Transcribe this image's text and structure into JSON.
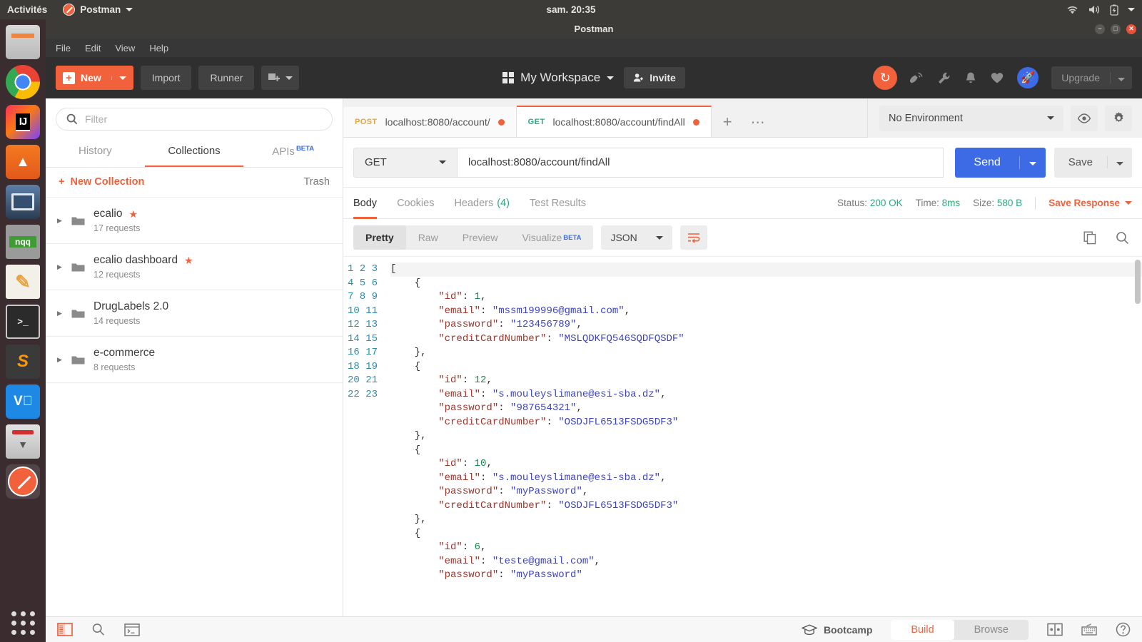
{
  "system": {
    "activities": "Activités",
    "app_menu": "Postman",
    "clock": "sam. 20:35",
    "tray_icons": [
      "wifi-icon",
      "volume-icon",
      "battery-icon",
      "chevron-down-icon"
    ]
  },
  "dock": {
    "items": [
      {
        "name": "files",
        "label": "Files",
        "running": true
      },
      {
        "name": "google-chrome",
        "label": "Google Chrome",
        "running": true
      },
      {
        "name": "intellij-idea",
        "label": "IJ",
        "running": true
      },
      {
        "name": "jetbrains-toolbox",
        "label": "Toolbox",
        "running": false
      },
      {
        "name": "virtualbox",
        "label": "VirtualBox",
        "running": false
      },
      {
        "name": "notepadqq",
        "label": "nqq",
        "running": false
      },
      {
        "name": "text-editor",
        "label": "Notes",
        "running": false
      },
      {
        "name": "terminal",
        "label": "Terminal",
        "running": true
      },
      {
        "name": "sublime-text",
        "label": "Sublime",
        "running": false
      },
      {
        "name": "vnc-viewer",
        "label": "VNC",
        "running": false
      },
      {
        "name": "scanner",
        "label": "Scanner",
        "running": false
      },
      {
        "name": "postman",
        "label": "Postman",
        "running": true
      }
    ],
    "show_apps": "Show Applications"
  },
  "window": {
    "title": "Postman",
    "minimize": "–",
    "maximize": "□",
    "close": "✕"
  },
  "menubar": {
    "items": [
      "File",
      "Edit",
      "View",
      "Help"
    ]
  },
  "header": {
    "new_label": "New",
    "import_label": "Import",
    "runner_label": "Runner",
    "workspace_label": "My Workspace",
    "invite_label": "Invite",
    "upgrade_label": "Upgrade",
    "icons": [
      "sync-icon",
      "satellite-icon",
      "wrench-icon",
      "bell-icon",
      "heart-icon",
      "rocket-icon"
    ]
  },
  "sidebar": {
    "filter_placeholder": "Filter",
    "tabs": [
      {
        "label": "History",
        "active": false,
        "badge": ""
      },
      {
        "label": "Collections",
        "active": true,
        "badge": ""
      },
      {
        "label": "APIs",
        "active": false,
        "badge": "BETA"
      }
    ],
    "new_collection_label": "New Collection",
    "trash_label": "Trash",
    "collections": [
      {
        "name": "ecalio",
        "count": "17 requests",
        "starred": true
      },
      {
        "name": "ecalio dashboard",
        "count": "12 requests",
        "starred": true
      },
      {
        "name": "DrugLabels 2.0",
        "count": "14 requests",
        "starred": false
      },
      {
        "name": "e-commerce",
        "count": "8 requests",
        "starred": false
      }
    ]
  },
  "request_tabs": [
    {
      "method": "POST",
      "url": "localhost:8080/account/",
      "active": false,
      "unsaved": true
    },
    {
      "method": "GET",
      "url": "localhost:8080/account/findAll",
      "active": true,
      "unsaved": true
    }
  ],
  "tabstrip": {
    "add_label": "+",
    "more_label": "⋯"
  },
  "environment": {
    "selected": "No Environment",
    "eye_icon": "eye-icon",
    "gear_icon": "gear-icon"
  },
  "request": {
    "method": "GET",
    "url": "localhost:8080/account/findAll",
    "send_label": "Send",
    "save_label": "Save"
  },
  "response": {
    "tabs": [
      {
        "label": "Body",
        "active": true,
        "count": ""
      },
      {
        "label": "Cookies",
        "active": false,
        "count": ""
      },
      {
        "label": "Headers",
        "active": false,
        "count": "(4)"
      },
      {
        "label": "Test Results",
        "active": false,
        "count": ""
      }
    ],
    "status_label": "Status:",
    "status_value": "200 OK",
    "time_label": "Time:",
    "time_value": "8ms",
    "size_label": "Size:",
    "size_value": "580 B",
    "save_response_label": "Save Response",
    "view_modes": [
      {
        "label": "Pretty",
        "active": true,
        "badge": ""
      },
      {
        "label": "Raw",
        "active": false,
        "badge": ""
      },
      {
        "label": "Preview",
        "active": false,
        "badge": ""
      },
      {
        "label": "Visualize",
        "active": false,
        "badge": "BETA"
      }
    ],
    "format": "JSON",
    "wrap_icon": "word-wrap-icon",
    "copy_icon": "copy-icon",
    "search_icon": "search-icon",
    "body_lines": [
      {
        "n": 1,
        "tokens": [
          {
            "t": "[",
            "c": "p"
          }
        ]
      },
      {
        "n": 2,
        "tokens": [
          {
            "t": "    {",
            "c": "p"
          }
        ]
      },
      {
        "n": 3,
        "tokens": [
          {
            "t": "        ",
            "c": "p"
          },
          {
            "t": "\"id\"",
            "c": "k"
          },
          {
            "t": ": ",
            "c": "p"
          },
          {
            "t": "1",
            "c": "n"
          },
          {
            "t": ",",
            "c": "p"
          }
        ]
      },
      {
        "n": 4,
        "tokens": [
          {
            "t": "        ",
            "c": "p"
          },
          {
            "t": "\"email\"",
            "c": "k"
          },
          {
            "t": ": ",
            "c": "p"
          },
          {
            "t": "\"mssm199996@gmail.com\"",
            "c": "s"
          },
          {
            "t": ",",
            "c": "p"
          }
        ]
      },
      {
        "n": 5,
        "tokens": [
          {
            "t": "        ",
            "c": "p"
          },
          {
            "t": "\"password\"",
            "c": "k"
          },
          {
            "t": ": ",
            "c": "p"
          },
          {
            "t": "\"123456789\"",
            "c": "s"
          },
          {
            "t": ",",
            "c": "p"
          }
        ]
      },
      {
        "n": 6,
        "tokens": [
          {
            "t": "        ",
            "c": "p"
          },
          {
            "t": "\"creditCardNumber\"",
            "c": "k"
          },
          {
            "t": ": ",
            "c": "p"
          },
          {
            "t": "\"MSLQDKFQ546SQDFQSDF\"",
            "c": "s"
          }
        ]
      },
      {
        "n": 7,
        "tokens": [
          {
            "t": "    },",
            "c": "p"
          }
        ]
      },
      {
        "n": 8,
        "tokens": [
          {
            "t": "    {",
            "c": "p"
          }
        ]
      },
      {
        "n": 9,
        "tokens": [
          {
            "t": "        ",
            "c": "p"
          },
          {
            "t": "\"id\"",
            "c": "k"
          },
          {
            "t": ": ",
            "c": "p"
          },
          {
            "t": "12",
            "c": "n"
          },
          {
            "t": ",",
            "c": "p"
          }
        ]
      },
      {
        "n": 10,
        "tokens": [
          {
            "t": "        ",
            "c": "p"
          },
          {
            "t": "\"email\"",
            "c": "k"
          },
          {
            "t": ": ",
            "c": "p"
          },
          {
            "t": "\"s.mouleyslimane@esi-sba.dz\"",
            "c": "s"
          },
          {
            "t": ",",
            "c": "p"
          }
        ]
      },
      {
        "n": 11,
        "tokens": [
          {
            "t": "        ",
            "c": "p"
          },
          {
            "t": "\"password\"",
            "c": "k"
          },
          {
            "t": ": ",
            "c": "p"
          },
          {
            "t": "\"987654321\"",
            "c": "s"
          },
          {
            "t": ",",
            "c": "p"
          }
        ]
      },
      {
        "n": 12,
        "tokens": [
          {
            "t": "        ",
            "c": "p"
          },
          {
            "t": "\"creditCardNumber\"",
            "c": "k"
          },
          {
            "t": ": ",
            "c": "p"
          },
          {
            "t": "\"OSDJFL6513FSDG5DF3\"",
            "c": "s"
          }
        ]
      },
      {
        "n": 13,
        "tokens": [
          {
            "t": "    },",
            "c": "p"
          }
        ]
      },
      {
        "n": 14,
        "tokens": [
          {
            "t": "    {",
            "c": "p"
          }
        ]
      },
      {
        "n": 15,
        "tokens": [
          {
            "t": "        ",
            "c": "p"
          },
          {
            "t": "\"id\"",
            "c": "k"
          },
          {
            "t": ": ",
            "c": "p"
          },
          {
            "t": "10",
            "c": "n"
          },
          {
            "t": ",",
            "c": "p"
          }
        ]
      },
      {
        "n": 16,
        "tokens": [
          {
            "t": "        ",
            "c": "p"
          },
          {
            "t": "\"email\"",
            "c": "k"
          },
          {
            "t": ": ",
            "c": "p"
          },
          {
            "t": "\"s.mouleyslimane@esi-sba.dz\"",
            "c": "s"
          },
          {
            "t": ",",
            "c": "p"
          }
        ]
      },
      {
        "n": 17,
        "tokens": [
          {
            "t": "        ",
            "c": "p"
          },
          {
            "t": "\"password\"",
            "c": "k"
          },
          {
            "t": ": ",
            "c": "p"
          },
          {
            "t": "\"myPassword\"",
            "c": "s"
          },
          {
            "t": ",",
            "c": "p"
          }
        ]
      },
      {
        "n": 18,
        "tokens": [
          {
            "t": "        ",
            "c": "p"
          },
          {
            "t": "\"creditCardNumber\"",
            "c": "k"
          },
          {
            "t": ": ",
            "c": "p"
          },
          {
            "t": "\"OSDJFL6513FSDG5DF3\"",
            "c": "s"
          }
        ]
      },
      {
        "n": 19,
        "tokens": [
          {
            "t": "    },",
            "c": "p"
          }
        ]
      },
      {
        "n": 20,
        "tokens": [
          {
            "t": "    {",
            "c": "p"
          }
        ]
      },
      {
        "n": 21,
        "tokens": [
          {
            "t": "        ",
            "c": "p"
          },
          {
            "t": "\"id\"",
            "c": "k"
          },
          {
            "t": ": ",
            "c": "p"
          },
          {
            "t": "6",
            "c": "n"
          },
          {
            "t": ",",
            "c": "p"
          }
        ]
      },
      {
        "n": 22,
        "tokens": [
          {
            "t": "        ",
            "c": "p"
          },
          {
            "t": "\"email\"",
            "c": "k"
          },
          {
            "t": ": ",
            "c": "p"
          },
          {
            "t": "\"teste@gmail.com\"",
            "c": "s"
          },
          {
            "t": ",",
            "c": "p"
          }
        ]
      },
      {
        "n": 23,
        "tokens": [
          {
            "t": "        ",
            "c": "p"
          },
          {
            "t": "\"password\"",
            "c": "k"
          },
          {
            "t": ": ",
            "c": "p"
          },
          {
            "t": "\"myPassword\"",
            "c": "s"
          }
        ]
      }
    ]
  },
  "statusbar": {
    "left_icons": [
      "sidebar-toggle-icon",
      "find-icon",
      "console-icon"
    ],
    "bootcamp_label": "Bootcamp",
    "build_label": "Build",
    "browse_label": "Browse",
    "right_icons": [
      "two-pane-icon",
      "keyboard-shortcuts-icon",
      "help-icon"
    ]
  },
  "colors": {
    "accent": "#f0613c",
    "send_blue": "#3d6be5",
    "status_green": "#2ca97a",
    "beta_blue": "#3d6be5"
  }
}
